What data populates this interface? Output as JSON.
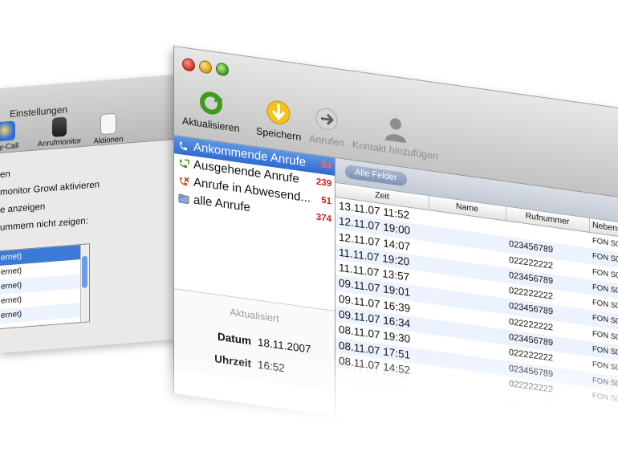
{
  "prefs_window": {
    "title": "Einstellungen",
    "tabs": [
      {
        "label": "-by-Call",
        "icon": "call-by-call-icon"
      },
      {
        "label": "Anrufmonitor",
        "icon": "anrufmonitor-icon"
      },
      {
        "label": "Aktionen",
        "icon": "aktionen-icon"
      }
    ],
    "options": [
      "en",
      "monitor Growl aktivieren",
      "e anzeigen",
      "ummern nicht zeigen:"
    ],
    "list_rows": [
      "ernet)",
      "ernet)",
      "ernet)",
      "ernet)",
      "ernet)"
    ]
  },
  "toolbar": {
    "refresh_label": "Aktualisieren",
    "save_label": "Speichern",
    "call_label": "Anrufen",
    "add_contact_label": "Kontakt hinzufügen"
  },
  "sidebar": {
    "items": [
      {
        "label": "Ankommende Anrufe",
        "count": "64",
        "icon": "incoming-call-icon"
      },
      {
        "label": "Ausgehende Anrufe",
        "count": "239",
        "icon": "outgoing-call-icon"
      },
      {
        "label": "Anrufe in Abwesend...",
        "count": "51",
        "icon": "missed-call-icon"
      },
      {
        "label": "alle Anrufe",
        "count": "374",
        "icon": "folder-icon"
      }
    ]
  },
  "info": {
    "updated_label": "Aktualisiert",
    "date_label": "Datum",
    "date_value": "18.11.2007",
    "time_label": "Uhrzeit",
    "time_value": "16:52"
  },
  "filter": {
    "chip_label": "Alle Felder"
  },
  "table": {
    "columns": [
      "Zeit",
      "Name",
      "Rufnummer",
      "Nebens"
    ],
    "rows": [
      {
        "zeit": "13.11.07 11:52",
        "name": "",
        "nummer": "",
        "neben": "FON S0"
      },
      {
        "zeit": "12.11.07 19:00",
        "name": "",
        "nummer": "023456789",
        "neben": "FON S0"
      },
      {
        "zeit": "12.11.07 14:07",
        "name": "",
        "nummer": "022222222",
        "neben": "FON S0"
      },
      {
        "zeit": "11.11.07 19:20",
        "name": "",
        "nummer": "023456789",
        "neben": "FON S0"
      },
      {
        "zeit": "11.11.07 13:57",
        "name": "",
        "nummer": "022222222",
        "neben": "FON S0"
      },
      {
        "zeit": "09.11.07 19:01",
        "name": "",
        "nummer": "023456789",
        "neben": "FON S0"
      },
      {
        "zeit": "09.11.07 16:39",
        "name": "",
        "nummer": "022222222",
        "neben": "FON S0"
      },
      {
        "zeit": "09.11.07 16:34",
        "name": "",
        "nummer": "023456789",
        "neben": "FON S0"
      },
      {
        "zeit": "08.11.07 19:30",
        "name": "",
        "nummer": "022222222",
        "neben": "FON S0"
      },
      {
        "zeit": "08.11.07 17:51",
        "name": "",
        "nummer": "023456789",
        "neben": "FON S0"
      },
      {
        "zeit": "08.11.07 14:52",
        "name": "",
        "nummer": "022222222",
        "neben": "FON S0"
      }
    ]
  },
  "colors": {
    "selection": "#2f6bd0",
    "count_red": "#d11c1c",
    "row_alt": "#edf3fe"
  }
}
